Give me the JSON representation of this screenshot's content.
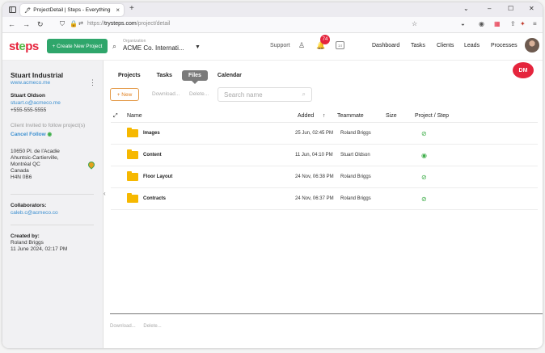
{
  "browser": {
    "tab_title": "ProjectDetail | Steps - Everything",
    "url_prefix": "https://",
    "url_host": "trysteps.com",
    "url_path": "/project/detail"
  },
  "header": {
    "logo": "steps",
    "create_button": "+ Create New Project",
    "org_label": "Organization",
    "org_name": "ACME Co. Internati...",
    "support": "Support",
    "notif_count": "74",
    "calendar_day": "14",
    "nav": [
      "Dashboard",
      "Tasks",
      "Clients",
      "Leads",
      "Processes"
    ]
  },
  "sidebar": {
    "client_name": "Stuart Industrial",
    "client_site": "www.acmeco.me",
    "contact_name": "Stuart Oldson",
    "contact_email": "stuart.o@acmeco.me",
    "contact_phone": "+555-555-5555",
    "invite_text": "Client Invited to follow project(s)",
    "cancel_follow": "Cancel Follow",
    "address": [
      "10650 Pl. de l'Acadie",
      "Ahuntsic-Cartierville,",
      "Montréal QC",
      "Canada",
      "H4N 0B6"
    ],
    "collaborators_label": "Collaborators:",
    "collaborator_email": "caleb.c@acmeco.co",
    "created_label": "Created by:",
    "created_by": "Roland Briggs",
    "created_date": "11 June 2024, 02:17 PM"
  },
  "main": {
    "tabs": [
      "Projects",
      "Tasks",
      "Files",
      "Calendar"
    ],
    "active_tab": "Files",
    "dm_badge": "DM",
    "new_button": "+ New",
    "download": "Download...",
    "delete": "Delete...",
    "search_placeholder": "Search name",
    "columns": {
      "name": "Name",
      "added": "Added",
      "sort_arrow": "↑",
      "teammate": "Teammate",
      "size": "Size",
      "project_step": "Project / Step"
    },
    "rows": [
      {
        "name": "Images",
        "added": "25 Jun, 02:45 PM",
        "teammate": "Roland Briggs",
        "visibility": "hidden"
      },
      {
        "name": "Content",
        "added": "11 Jun, 04:10 PM",
        "teammate": "Stuart Oldson",
        "visibility": "visible"
      },
      {
        "name": "Floor Layout",
        "added": "24 Nov, 06:38 PM",
        "teammate": "Roland Briggs",
        "visibility": "hidden"
      },
      {
        "name": "Contracts",
        "added": "24 Nov, 06:37 PM",
        "teammate": "Roland Briggs",
        "visibility": "hidden"
      }
    ],
    "footer_download": "Download...",
    "footer_delete": "Delete..."
  },
  "colors": {
    "brand_red": "#e5253d",
    "brand_green": "#2fa66b",
    "accent_orange": "#e07f1d",
    "link_blue": "#3b8fd0",
    "folder_yellow": "#f6b800"
  }
}
